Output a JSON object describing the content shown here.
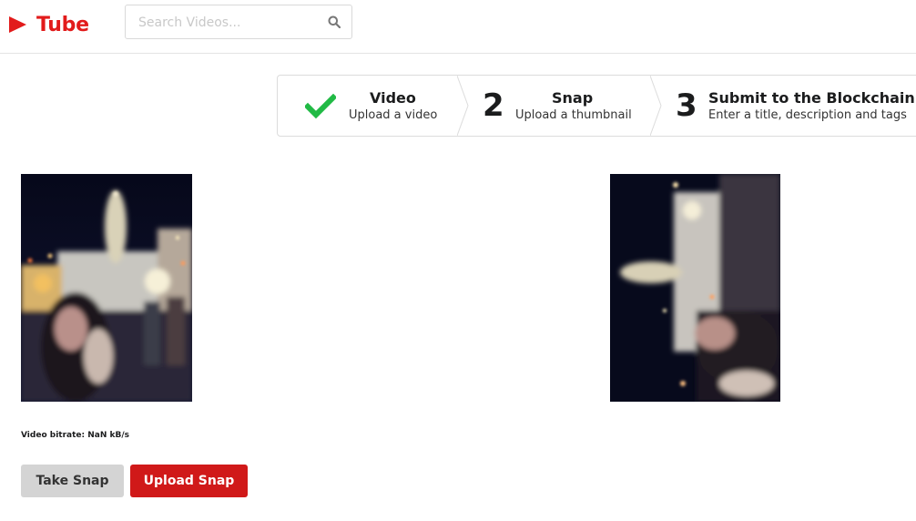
{
  "app": {
    "title": "Tube",
    "brand_color": "#e21b1b",
    "logo_icon": "play-triangle-icon"
  },
  "search": {
    "placeholder": "Search Videos...",
    "icon": "search-icon"
  },
  "steps": [
    {
      "icon": "checkmark-icon",
      "number": "",
      "title": "Video",
      "description": "Upload a video",
      "status": "completed"
    },
    {
      "icon": "",
      "number": "2",
      "title": "Snap",
      "description": "Upload a thumbnail",
      "status": "active"
    },
    {
      "icon": "",
      "number": "3",
      "title": "Submit to the Blockchain",
      "description": "Enter a title, description and tags",
      "status": "pending"
    }
  ],
  "media": {
    "video_preview": "video-player",
    "snapshot_preview": "thumbnail-preview"
  },
  "status": {
    "bitrate": "Video bitrate: NaN kB/s"
  },
  "buttons": {
    "take_snap": "Take Snap",
    "upload_snap": "Upload Snap"
  },
  "colors": {
    "primary_red": "#d01919",
    "secondary_gray": "#d4d4d4",
    "check_green": "#21ba45"
  }
}
